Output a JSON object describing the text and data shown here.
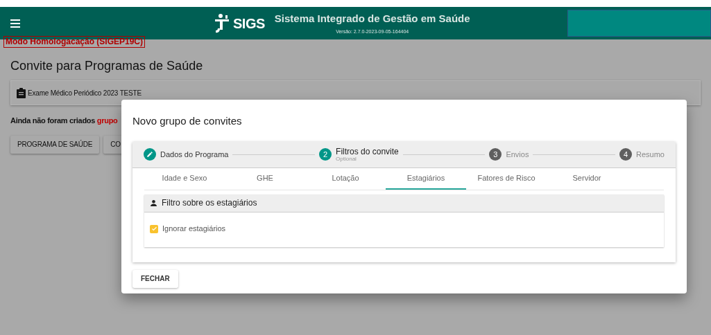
{
  "header": {
    "logo_text": "SIGS",
    "title": "Sistema Integrado de Gestão em Saúde",
    "version": "Versão: 2.7.0-2023-09-05-164404"
  },
  "mode_badge": "Modo Homologacação (SIGEP19C)",
  "page_title": "Convite para Programas de Saúde",
  "program_card": "Exame Médico Periódico 2023 TESTE",
  "notice": {
    "text": "Ainda não foram criados ",
    "highlight": "grupo"
  },
  "page_buttons": [
    "PROGRAMA DE SAÚDE",
    "CO"
  ],
  "dialog": {
    "title": "Novo grupo de convites",
    "steps": [
      {
        "label": "Dados do Programa",
        "completed": true,
        "active": false
      },
      {
        "number": "2",
        "label": "Filtros do convite",
        "sublabel": "Optional",
        "completed": false,
        "active": true
      },
      {
        "number": "3",
        "label": "Envios",
        "completed": false,
        "active": false
      },
      {
        "number": "4",
        "label": "Resumo",
        "completed": false,
        "active": false
      }
    ],
    "tabs": [
      {
        "label": "Idade e Sexo",
        "selected": false
      },
      {
        "label": "GHE",
        "selected": false
      },
      {
        "label": "Lotação",
        "selected": false
      },
      {
        "label": "Estagiários",
        "selected": true
      },
      {
        "label": "Fatores de Risco",
        "selected": false
      },
      {
        "label": "Servidor",
        "selected": false
      }
    ],
    "section_title": "Filtro sobre os estagiários",
    "checkbox": {
      "label": "Ignorar estagiários",
      "checked": true
    },
    "close_button": "FECHAR"
  }
}
